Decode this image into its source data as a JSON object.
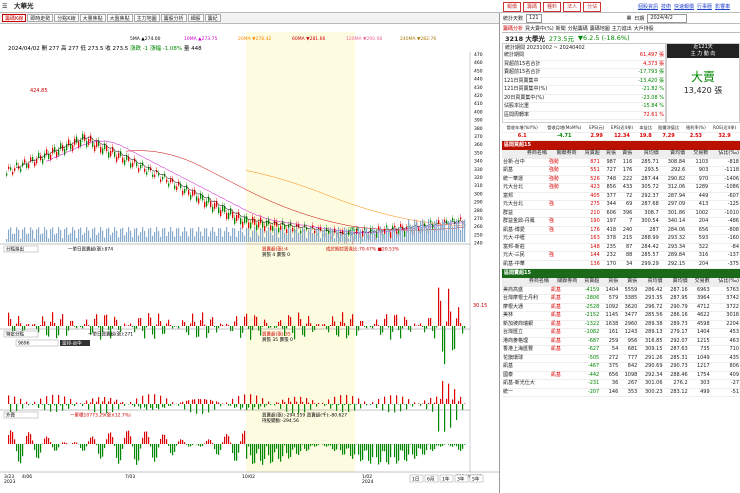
{
  "window": {
    "title": "大華光"
  },
  "top_buttons": [
    "報價",
    "籌碼",
    "種料",
    "法人",
    "分佔"
  ],
  "top_links": [
    "個股資訊",
    "技術",
    "快速報價",
    "行事曆",
    "影響車"
  ],
  "tabs": [
    "籌碼K線",
    "即時走勢",
    "分點K線",
    "大量焦點",
    "大盤焦點",
    "主力地圖",
    "籌股分析",
    "細股",
    "籌紀"
  ],
  "ma_legend": [
    "5MA ▲274.00",
    "10MA ▲273.75",
    "20MA ▼278.42",
    "60MA ▼281.66",
    "120MA ▼290.08",
    "240MA ▼282.76"
  ],
  "ohlc": {
    "date": "2024/04/02",
    "open": "開 277",
    "high": "高 277",
    "low": "低 273.5",
    "close": "收 273.5",
    "change": "漲跌 -1",
    "pct": "漲幅 -1.08%",
    "vol": "量 448"
  },
  "y_ticks": [
    "470",
    "460",
    "450",
    "440",
    "430",
    "420",
    "410",
    "400",
    "390",
    "380",
    "370",
    "360",
    "350",
    "340",
    "330",
    "320",
    "310",
    "300",
    "290",
    "280",
    "270",
    "260",
    "250",
    "240"
  ],
  "marks": {
    "high": "424.85",
    "low": "264"
  },
  "panel2": {
    "select": "分點進出",
    "label": "一單日買賣超(張):874",
    "stat": "買賣超(張):4",
    "stat2": "買張 4 賣張 0",
    "pct": "成於期控買進比:79.47%  ■20.53%",
    "value": "30.15"
  },
  "panel3": {
    "select": "特定分點",
    "input": "9696",
    "note": "富邦-台中",
    "label": "一單日買賣超(張):271",
    "stat": "買賣超(張):35",
    "stat2": "買張 35 賣張 0"
  },
  "panel4": {
    "select": "外資",
    "label": "一累積10773.29(張)(12.7%)",
    "stat": "買賣超(張):-294.559 買賣超(千):-80.627",
    "stat2": "持股變動:-294.56"
  },
  "x_labels": [
    "3/23",
    "4/06",
    "7/03",
    "10/02",
    "1/02",
    "2024/04/02"
  ],
  "x_year": [
    "2023",
    "2024"
  ],
  "bottom_buttons": [
    "1日",
    "6月",
    "1年",
    "3年",
    "5年"
  ],
  "right": {
    "select_label": "統計天數",
    "days": "121",
    "date_label": "日期",
    "date": "2024/4/2",
    "sub_tabs": [
      "籌碼分析",
      "買大賣中(%)",
      "新聞",
      "分點籌碼",
      "籌碼地圖",
      "主力進出",
      "大戶持股"
    ],
    "stock": "3218 大學光",
    "price": "273.5元",
    "chg": "▼6.2.5 (-18.6%)",
    "period": "統計期間 20231002 ~ 20240402",
    "big_label": "近121天",
    "big_label2": "主 力 動 向",
    "stats": [
      [
        "統計期間",
        "61,497 張"
      ],
      [
        "買超前15名合計",
        "4,373 張"
      ],
      [
        "賣超前15名合計",
        "-17,793 張"
      ],
      [
        "121日買賣集中",
        "-13,420 張"
      ],
      [
        "121日買賣集中(%)",
        "-21.82 %"
      ],
      [
        "20日買賣集中(%)",
        "-23.08 %"
      ],
      [
        "佔股本比重",
        "-15.84 %"
      ],
      [
        "區間周轉率",
        "72.61 %"
      ]
    ],
    "verdict": "大賣",
    "verdict_val": "13,420 張",
    "metrics_head": [
      "營收年增(YoY%)",
      "營收月增(MoM%)",
      "EPS(元)",
      "EPS(近4季)",
      "本益比",
      "股價淨值比",
      "殖利率(%)",
      "ROE(近4季)"
    ],
    "metrics": [
      "6.1",
      "-4.71",
      "2.99",
      "12.34",
      "19.8",
      "7.29",
      "2.53",
      "32.9"
    ],
    "buy_title": "區間買超15",
    "sell_title": "區間賣超15",
    "cols": [
      "券商名稱",
      "關聯券商",
      "買賣超",
      "買張",
      "賣張",
      "買均價",
      "賣均價",
      "交易數",
      "佔比(‰)"
    ],
    "buy_rows": [
      [
        "台新-台中",
        "強勢",
        "871",
        "987",
        "116",
        "285.71",
        "308.84",
        "1103",
        "-818"
      ],
      [
        "凱基",
        "強勢",
        "551",
        "727",
        "176",
        "293.5",
        "292.6",
        "903",
        "-1118"
      ],
      [
        "統一華運",
        "強勢",
        "526",
        "748",
        "222",
        "287.44",
        "290.82",
        "970",
        "-1406"
      ],
      [
        "元大台北",
        "強勢",
        "423",
        "856",
        "433",
        "305.72",
        "312.06",
        "1289",
        "-1086"
      ],
      [
        "富邦",
        "",
        "405",
        "377",
        "72",
        "292.37",
        "287.94",
        "449",
        "-607"
      ],
      [
        "元大台北",
        "強",
        "275",
        "344",
        "69",
        "287.68",
        "297.09",
        "413",
        "-125"
      ],
      [
        "群益",
        "",
        "210",
        "606",
        "396",
        "308.7",
        "301.86",
        "1002",
        "-1010"
      ],
      [
        "群益金鼎-丹鳳",
        "強",
        "190",
        "197",
        "7",
        "300.54",
        "340.14",
        "204",
        "-486"
      ],
      [
        "凱基-博愛",
        "強",
        "176",
        "418",
        "240",
        "287",
        "284.06",
        "656",
        "-808"
      ],
      [
        "元大-中壢",
        "",
        "163",
        "378",
        "215",
        "288.99",
        "293.32",
        "593",
        "-160"
      ],
      [
        "富邦-新莊",
        "",
        "148",
        "235",
        "87",
        "284.42",
        "293.34",
        "322",
        "-84"
      ],
      [
        "元大-三民",
        "強",
        "144",
        "232",
        "88",
        "285.57",
        "289.84",
        "316",
        "-137"
      ],
      [
        "凱基-中華",
        "",
        "136",
        "170",
        "34",
        "299.29",
        "292.15",
        "204",
        "-375"
      ]
    ],
    "sell_rows": [
      [
        "美商高盛",
        "凱基",
        "-4159",
        "1404",
        "5559",
        "286.42",
        "287.16",
        "6963",
        "5763"
      ],
      [
        "台灣摩根士丹利",
        "凱基",
        "-2806",
        "579",
        "3385",
        "293.35",
        "287.95",
        "3964",
        "3742"
      ],
      [
        "摩根大通",
        "凱基",
        "-2528",
        "1092",
        "3620",
        "296.72",
        "290.79",
        "4712",
        "3722"
      ],
      [
        "美林",
        "凱基",
        "-2152",
        "1145",
        "3477",
        "285.56",
        "286.16",
        "4622",
        "3018"
      ],
      [
        "新加坡商瑞銀",
        "凱基",
        "-1322",
        "1638",
        "2960",
        "289.38",
        "289.73",
        "4598",
        "2204"
      ],
      [
        "台灣匯立",
        "凱基",
        "-1082",
        "161",
        "1243",
        "289.13",
        "279.17",
        "1404",
        "453"
      ],
      [
        "港商麥格理",
        "凱基",
        "-687",
        "259",
        "956",
        "316.85",
        "292.07",
        "1215",
        "463"
      ],
      [
        "香港上海匯豐",
        "凱基",
        "-627",
        "54",
        "681",
        "309.15",
        "287.63",
        "735",
        "710"
      ],
      [
        "花旗環球",
        "",
        "-505",
        "272",
        "777",
        "291.26",
        "285.31",
        "1049",
        "435"
      ],
      [
        "凱基",
        "",
        "-467",
        "375",
        "842",
        "290.69",
        "290.73",
        "1217",
        "806"
      ],
      [
        "國泰",
        "凱基",
        "-442",
        "656",
        "1098",
        "292.34",
        "288.46",
        "1754",
        "409"
      ],
      [
        "凱基-新光仕大",
        "",
        "-231",
        "36",
        "267",
        "301.06",
        "276.2",
        "303",
        "-27"
      ],
      [
        "統一",
        "",
        "-207",
        "146",
        "353",
        "300.23",
        "283.12",
        "499",
        "-51"
      ]
    ]
  }
}
